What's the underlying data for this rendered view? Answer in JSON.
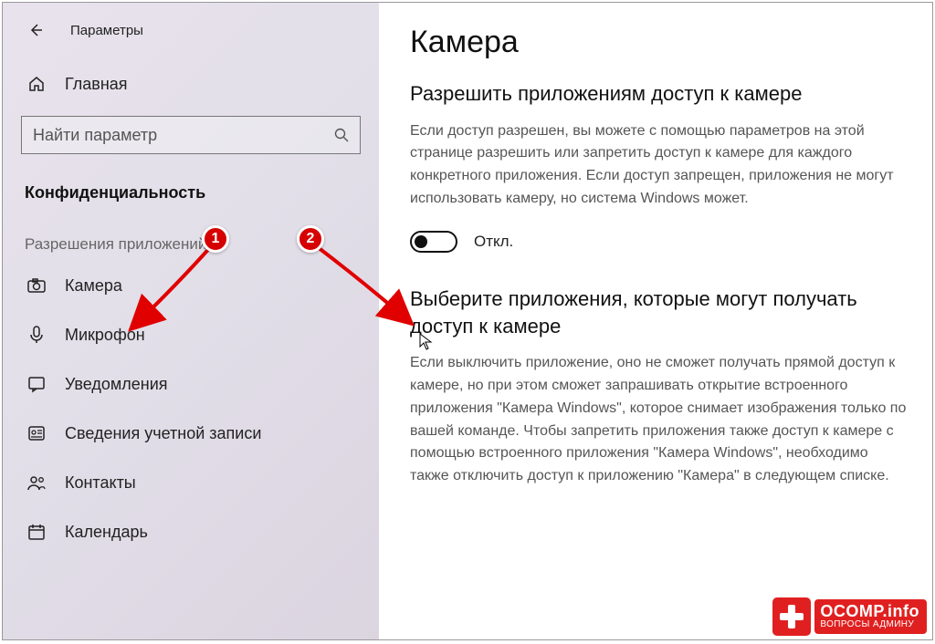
{
  "header": {
    "title": "Параметры"
  },
  "sidebar": {
    "home": "Главная",
    "search_placeholder": "Найти параметр",
    "section": "Конфиденциальность",
    "group": "Разрешения приложений",
    "items": [
      {
        "icon": "camera",
        "label": "Камера"
      },
      {
        "icon": "microphone",
        "label": "Микрофон"
      },
      {
        "icon": "notifications",
        "label": "Уведомления"
      },
      {
        "icon": "account",
        "label": "Сведения учетной записи"
      },
      {
        "icon": "contacts",
        "label": "Контакты"
      },
      {
        "icon": "calendar",
        "label": "Календарь"
      }
    ]
  },
  "content": {
    "title": "Камера",
    "section1_title": "Разрешить приложениям доступ к камере",
    "section1_body": "Если доступ разрешен, вы можете с помощью параметров на этой странице разрешить или запретить доступ к камере для каждого конкретного приложения. Если доступ запрещен, приложения не могут использовать камеру, но система Windows может.",
    "toggle_label": "Откл.",
    "toggle_state": "off",
    "section2_title": "Выберите приложения, которые могут получать доступ к камере",
    "section2_body": "Если выключить приложение, оно не сможет получать прямой доступ к камере, но при этом сможет запрашивать открытие встроенного приложения \"Камера Windows\", которое снимает изображения только по вашей команде. Чтобы запретить приложения также доступ к камере с помощью встроенного приложения \"Камера Windows\", необходимо также отключить доступ к приложению \"Камера\" в следующем списке."
  },
  "annotations": {
    "badge1": "1",
    "badge2": "2"
  },
  "watermark": {
    "site": "OCOMP.info",
    "tagline": "ВОПРОСЫ АДМИНУ"
  }
}
